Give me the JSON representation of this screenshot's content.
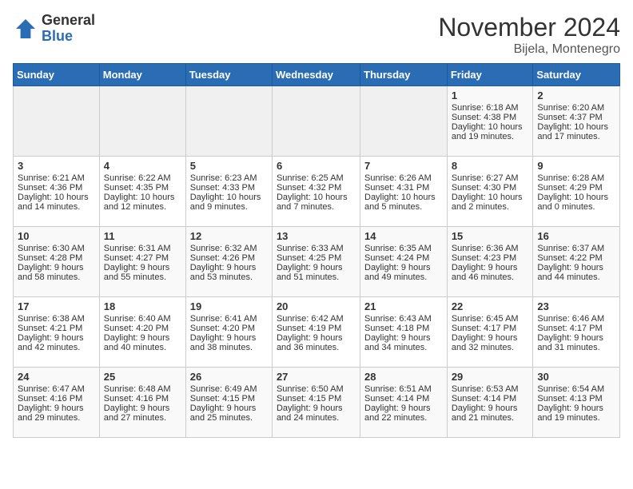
{
  "logo": {
    "general": "General",
    "blue": "Blue"
  },
  "title": "November 2024",
  "location": "Bijela, Montenegro",
  "days_of_week": [
    "Sunday",
    "Monday",
    "Tuesday",
    "Wednesday",
    "Thursday",
    "Friday",
    "Saturday"
  ],
  "weeks": [
    [
      {
        "day": "",
        "empty": true
      },
      {
        "day": "",
        "empty": true
      },
      {
        "day": "",
        "empty": true
      },
      {
        "day": "",
        "empty": true
      },
      {
        "day": "",
        "empty": true
      },
      {
        "day": "1",
        "sunrise": "Sunrise: 6:18 AM",
        "sunset": "Sunset: 4:38 PM",
        "daylight": "Daylight: 10 hours and 19 minutes."
      },
      {
        "day": "2",
        "sunrise": "Sunrise: 6:20 AM",
        "sunset": "Sunset: 4:37 PM",
        "daylight": "Daylight: 10 hours and 17 minutes."
      }
    ],
    [
      {
        "day": "3",
        "sunrise": "Sunrise: 6:21 AM",
        "sunset": "Sunset: 4:36 PM",
        "daylight": "Daylight: 10 hours and 14 minutes."
      },
      {
        "day": "4",
        "sunrise": "Sunrise: 6:22 AM",
        "sunset": "Sunset: 4:35 PM",
        "daylight": "Daylight: 10 hours and 12 minutes."
      },
      {
        "day": "5",
        "sunrise": "Sunrise: 6:23 AM",
        "sunset": "Sunset: 4:33 PM",
        "daylight": "Daylight: 10 hours and 9 minutes."
      },
      {
        "day": "6",
        "sunrise": "Sunrise: 6:25 AM",
        "sunset": "Sunset: 4:32 PM",
        "daylight": "Daylight: 10 hours and 7 minutes."
      },
      {
        "day": "7",
        "sunrise": "Sunrise: 6:26 AM",
        "sunset": "Sunset: 4:31 PM",
        "daylight": "Daylight: 10 hours and 5 minutes."
      },
      {
        "day": "8",
        "sunrise": "Sunrise: 6:27 AM",
        "sunset": "Sunset: 4:30 PM",
        "daylight": "Daylight: 10 hours and 2 minutes."
      },
      {
        "day": "9",
        "sunrise": "Sunrise: 6:28 AM",
        "sunset": "Sunset: 4:29 PM",
        "daylight": "Daylight: 10 hours and 0 minutes."
      }
    ],
    [
      {
        "day": "10",
        "sunrise": "Sunrise: 6:30 AM",
        "sunset": "Sunset: 4:28 PM",
        "daylight": "Daylight: 9 hours and 58 minutes."
      },
      {
        "day": "11",
        "sunrise": "Sunrise: 6:31 AM",
        "sunset": "Sunset: 4:27 PM",
        "daylight": "Daylight: 9 hours and 55 minutes."
      },
      {
        "day": "12",
        "sunrise": "Sunrise: 6:32 AM",
        "sunset": "Sunset: 4:26 PM",
        "daylight": "Daylight: 9 hours and 53 minutes."
      },
      {
        "day": "13",
        "sunrise": "Sunrise: 6:33 AM",
        "sunset": "Sunset: 4:25 PM",
        "daylight": "Daylight: 9 hours and 51 minutes."
      },
      {
        "day": "14",
        "sunrise": "Sunrise: 6:35 AM",
        "sunset": "Sunset: 4:24 PM",
        "daylight": "Daylight: 9 hours and 49 minutes."
      },
      {
        "day": "15",
        "sunrise": "Sunrise: 6:36 AM",
        "sunset": "Sunset: 4:23 PM",
        "daylight": "Daylight: 9 hours and 46 minutes."
      },
      {
        "day": "16",
        "sunrise": "Sunrise: 6:37 AM",
        "sunset": "Sunset: 4:22 PM",
        "daylight": "Daylight: 9 hours and 44 minutes."
      }
    ],
    [
      {
        "day": "17",
        "sunrise": "Sunrise: 6:38 AM",
        "sunset": "Sunset: 4:21 PM",
        "daylight": "Daylight: 9 hours and 42 minutes."
      },
      {
        "day": "18",
        "sunrise": "Sunrise: 6:40 AM",
        "sunset": "Sunset: 4:20 PM",
        "daylight": "Daylight: 9 hours and 40 minutes."
      },
      {
        "day": "19",
        "sunrise": "Sunrise: 6:41 AM",
        "sunset": "Sunset: 4:20 PM",
        "daylight": "Daylight: 9 hours and 38 minutes."
      },
      {
        "day": "20",
        "sunrise": "Sunrise: 6:42 AM",
        "sunset": "Sunset: 4:19 PM",
        "daylight": "Daylight: 9 hours and 36 minutes."
      },
      {
        "day": "21",
        "sunrise": "Sunrise: 6:43 AM",
        "sunset": "Sunset: 4:18 PM",
        "daylight": "Daylight: 9 hours and 34 minutes."
      },
      {
        "day": "22",
        "sunrise": "Sunrise: 6:45 AM",
        "sunset": "Sunset: 4:17 PM",
        "daylight": "Daylight: 9 hours and 32 minutes."
      },
      {
        "day": "23",
        "sunrise": "Sunrise: 6:46 AM",
        "sunset": "Sunset: 4:17 PM",
        "daylight": "Daylight: 9 hours and 31 minutes."
      }
    ],
    [
      {
        "day": "24",
        "sunrise": "Sunrise: 6:47 AM",
        "sunset": "Sunset: 4:16 PM",
        "daylight": "Daylight: 9 hours and 29 minutes."
      },
      {
        "day": "25",
        "sunrise": "Sunrise: 6:48 AM",
        "sunset": "Sunset: 4:16 PM",
        "daylight": "Daylight: 9 hours and 27 minutes."
      },
      {
        "day": "26",
        "sunrise": "Sunrise: 6:49 AM",
        "sunset": "Sunset: 4:15 PM",
        "daylight": "Daylight: 9 hours and 25 minutes."
      },
      {
        "day": "27",
        "sunrise": "Sunrise: 6:50 AM",
        "sunset": "Sunset: 4:15 PM",
        "daylight": "Daylight: 9 hours and 24 minutes."
      },
      {
        "day": "28",
        "sunrise": "Sunrise: 6:51 AM",
        "sunset": "Sunset: 4:14 PM",
        "daylight": "Daylight: 9 hours and 22 minutes."
      },
      {
        "day": "29",
        "sunrise": "Sunrise: 6:53 AM",
        "sunset": "Sunset: 4:14 PM",
        "daylight": "Daylight: 9 hours and 21 minutes."
      },
      {
        "day": "30",
        "sunrise": "Sunrise: 6:54 AM",
        "sunset": "Sunset: 4:13 PM",
        "daylight": "Daylight: 9 hours and 19 minutes."
      }
    ]
  ]
}
